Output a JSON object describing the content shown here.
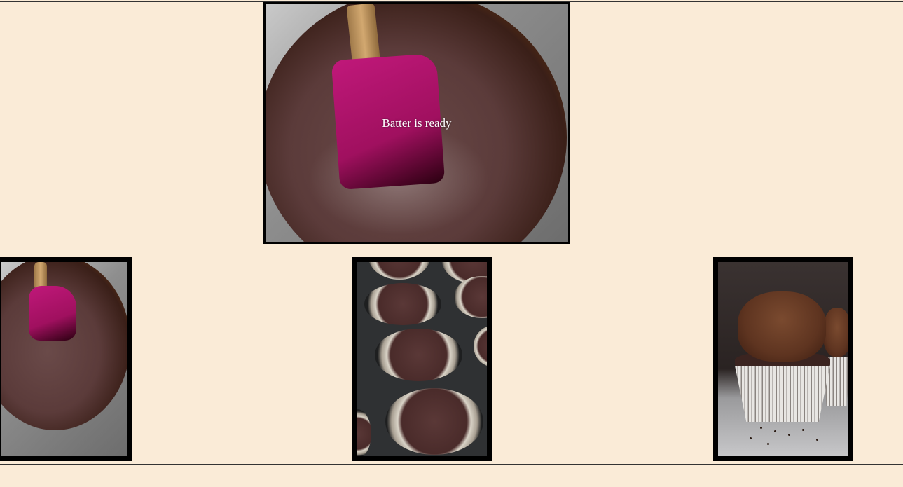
{
  "gallery": {
    "featured": {
      "caption": "Batter is ready",
      "image": "chocolate-batter-bowl"
    },
    "thumbnails": [
      {
        "image": "chocolate-batter-bowl"
      },
      {
        "image": "muffin-tin-filled"
      },
      {
        "image": "chocolate-cupcake"
      }
    ]
  },
  "colors": {
    "page_background": "#faebd7",
    "frame_border": "#000000",
    "caption_text": "#ffffff"
  }
}
